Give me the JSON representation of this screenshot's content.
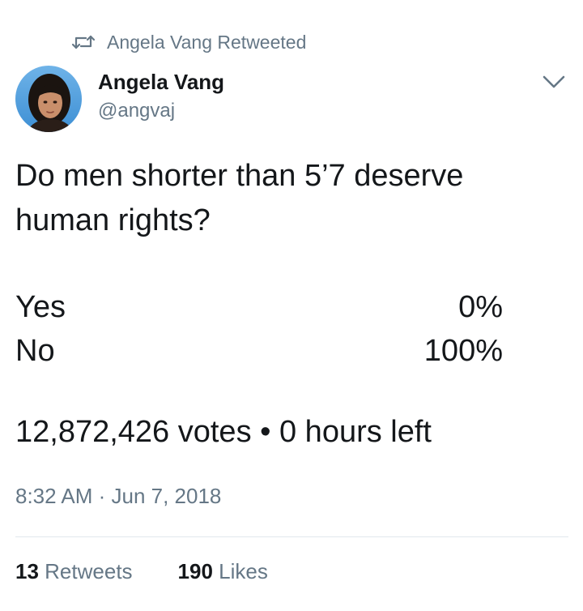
{
  "retweet_context": {
    "icon": "retweet-icon",
    "text": "Angela Vang Retweeted"
  },
  "author": {
    "name": "Angela Vang",
    "handle": "@angvaj",
    "avatar": "profile-photo"
  },
  "menu_icon": "chevron-down-icon",
  "tweet": {
    "text": "Do men shorter than 5’7 deserve human rights?"
  },
  "poll": {
    "options": [
      {
        "label": "Yes",
        "percent": "0%"
      },
      {
        "label": "No",
        "percent": "100%"
      }
    ],
    "summary": "12,872,426 votes • 0 hours left"
  },
  "timestamp": "8:32 AM · Jun 7, 2018",
  "stats": {
    "retweets": {
      "count": "13",
      "label": "Retweets"
    },
    "likes": {
      "count": "190",
      "label": "Likes"
    }
  },
  "colors": {
    "primary_text": "#14171a",
    "secondary_text": "#657786",
    "divider": "#e1e8ed"
  }
}
